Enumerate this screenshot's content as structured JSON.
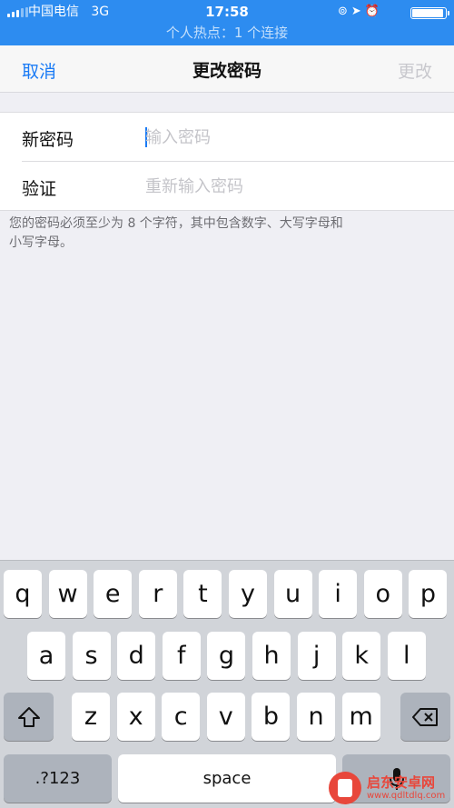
{
  "status_bar": {
    "carrier": "中国电信",
    "network": "3G",
    "time": "17:58",
    "indicator_icons": [
      "orientation-lock-icon",
      "location-icon",
      "alarm-icon"
    ],
    "battery_level": 0.95,
    "hotspot_text": "个人热点：1 个连接",
    "background_color": "#2d8cf0"
  },
  "nav": {
    "cancel_label": "取消",
    "title": "更改密码",
    "change_label": "更改",
    "accent_color": "#1a7bf5"
  },
  "form": {
    "new_password_label": "新密码",
    "new_password_placeholder": "输入密码",
    "new_password_value": "",
    "verify_label": "验证",
    "verify_placeholder": "重新输入密码",
    "verify_value": ""
  },
  "hint": {
    "line1": "您的密码必须至少为 8 个字符，其中包含数字、大写字母和",
    "line2": "小写字母。"
  },
  "keyboard": {
    "row1": [
      "q",
      "w",
      "e",
      "r",
      "t",
      "y",
      "u",
      "i",
      "o",
      "p"
    ],
    "row2": [
      "a",
      "s",
      "d",
      "f",
      "g",
      "h",
      "j",
      "k",
      "l"
    ],
    "row3": [
      "z",
      "x",
      "c",
      "v",
      "b",
      "n",
      "m"
    ],
    "numbers_label": ".?123",
    "space_label": "space",
    "icons": [
      "shift-icon",
      "delete-icon",
      "microphone-icon"
    ]
  },
  "watermark": {
    "name": "启东安卓网",
    "url": "www.qdltdlq.com",
    "color": "#e8473b"
  }
}
